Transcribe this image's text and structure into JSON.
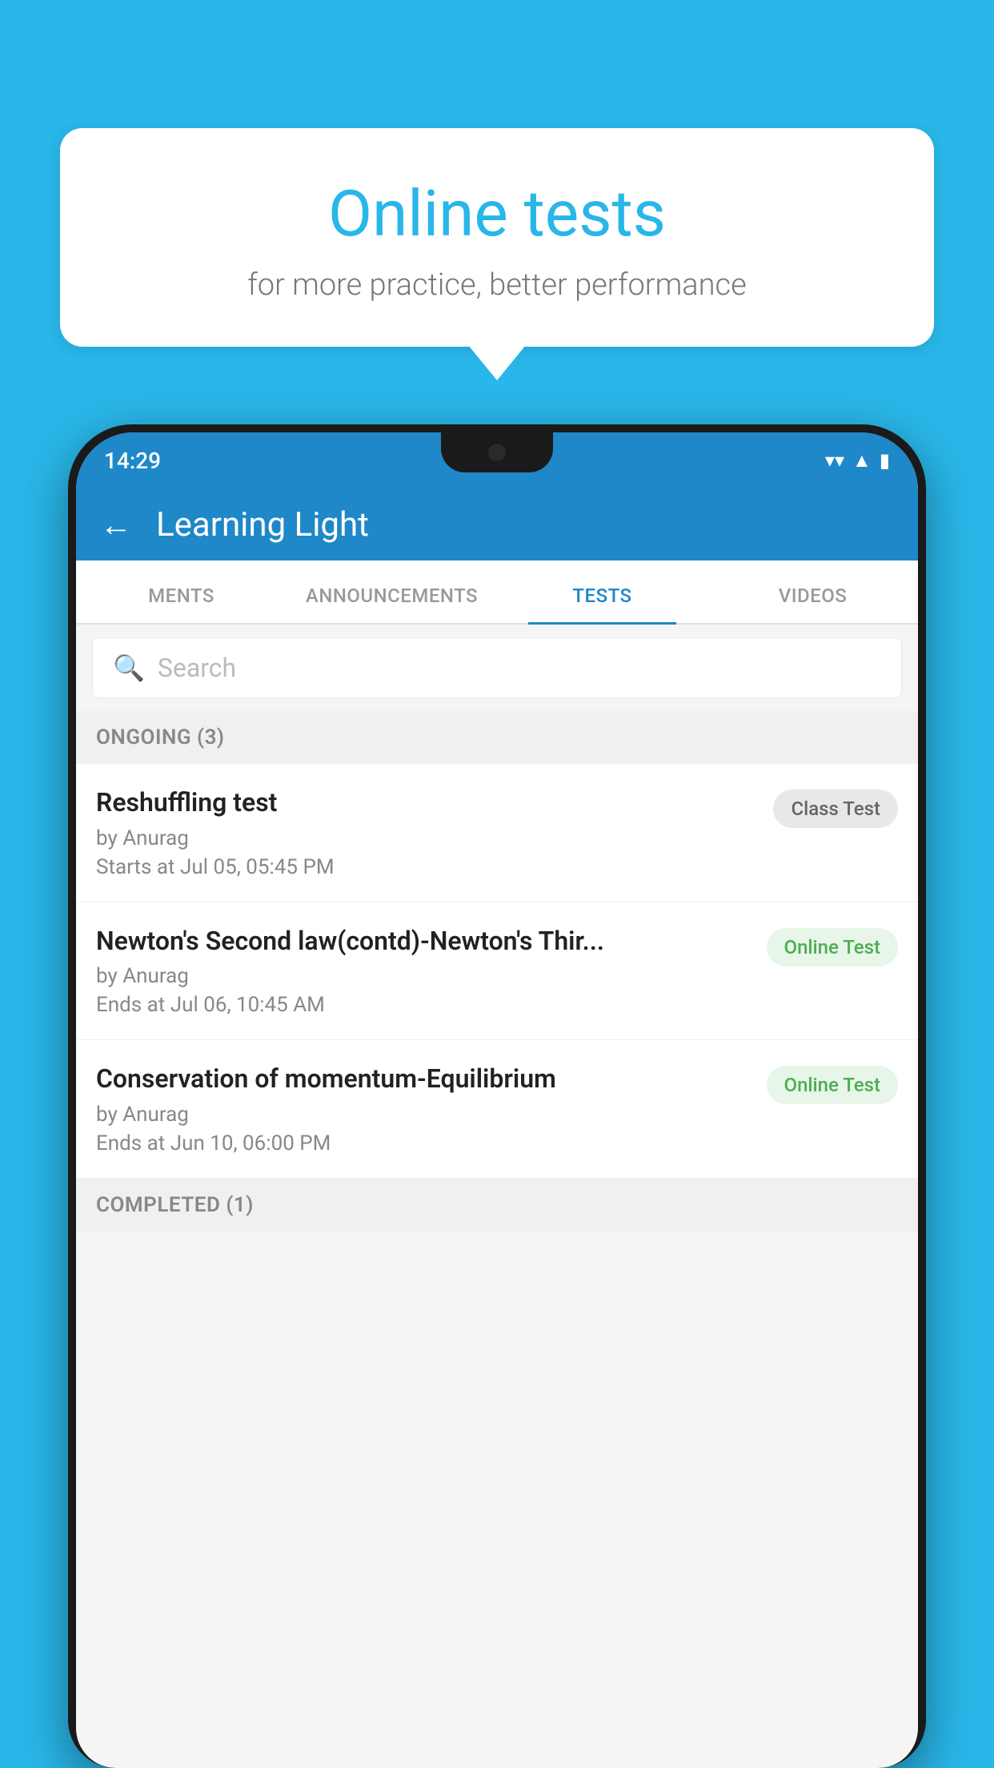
{
  "background_color": "#29b6e8",
  "bubble": {
    "title": "Online tests",
    "subtitle": "for more practice, better performance"
  },
  "status_bar": {
    "time": "14:29",
    "wifi_icon": "▼",
    "signal_icon": "▲",
    "battery_icon": "▮"
  },
  "header": {
    "back_label": "←",
    "title": "Learning Light"
  },
  "tabs": [
    {
      "label": "MENTS",
      "active": false
    },
    {
      "label": "ANNOUNCEMENTS",
      "active": false
    },
    {
      "label": "TESTS",
      "active": true
    },
    {
      "label": "VIDEOS",
      "active": false
    }
  ],
  "search": {
    "placeholder": "Search"
  },
  "ongoing_section": {
    "label": "ONGOING (3)"
  },
  "tests": [
    {
      "name": "Reshuffling test",
      "by": "by Anurag",
      "time_label": "Starts at",
      "time": "Jul 05, 05:45 PM",
      "badge": "Class Test",
      "badge_type": "class"
    },
    {
      "name": "Newton's Second law(contd)-Newton's Thir...",
      "by": "by Anurag",
      "time_label": "Ends at",
      "time": "Jul 06, 10:45 AM",
      "badge": "Online Test",
      "badge_type": "online"
    },
    {
      "name": "Conservation of momentum-Equilibrium",
      "by": "by Anurag",
      "time_label": "Ends at",
      "time": "Jun 10, 06:00 PM",
      "badge": "Online Test",
      "badge_type": "online"
    }
  ],
  "completed_section": {
    "label": "COMPLETED (1)"
  }
}
